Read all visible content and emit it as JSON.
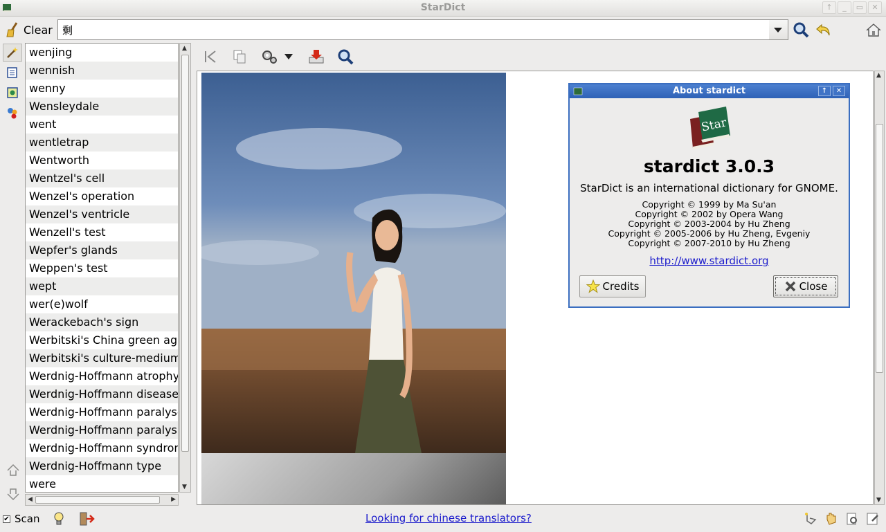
{
  "window": {
    "title": "StarDict"
  },
  "toolbar": {
    "clear_label": "Clear",
    "search_value": "剩"
  },
  "word_list": [
    "wenjing",
    "wennish",
    "wenny",
    "Wensleydale",
    "went",
    "wentletrap",
    "Wentworth",
    "Wentzel's cell",
    "Wenzel's operation",
    "Wenzel's ventricle",
    "Wenzell's test",
    "Wepfer's glands",
    "Weppen's test",
    "wept",
    "wer(e)wolf",
    "Werackebach's sign",
    "Werbitski's China green agar",
    "Werbitski's culture-medium",
    "Werdnig-Hoffmann atrophy",
    "Werdnig-Hoffmann disease",
    "Werdnig-Hoffmann paralyses",
    "Werdnig-Hoffmann paralysis",
    "Werdnig-Hoffmann syndrome",
    "Werdnig-Hoffmann type",
    "were"
  ],
  "about": {
    "title": "About stardict",
    "logo_text": "Star",
    "program": "stardict 3.0.3",
    "comments": "StarDict is an international dictionary for GNOME.",
    "copyright": [
      "Copyright © 1999 by Ma Su'an",
      "Copyright © 2002 by Opera Wang",
      "Copyright © 2003-2004 by Hu Zheng",
      "Copyright © 2005-2006 by Hu Zheng, Evgeniy",
      "Copyright © 2007-2010 by Hu Zheng"
    ],
    "website": "http://www.stardict.org",
    "credits_label": "Credits",
    "close_label": "Close"
  },
  "statusbar": {
    "scan_label": "Scan",
    "scan_checked": true,
    "link_text": "Looking for chinese translators?"
  },
  "colors": {
    "accent": "#3b6ec0",
    "link": "#1c1ccc",
    "titlebar_text": "#9a9a98"
  }
}
